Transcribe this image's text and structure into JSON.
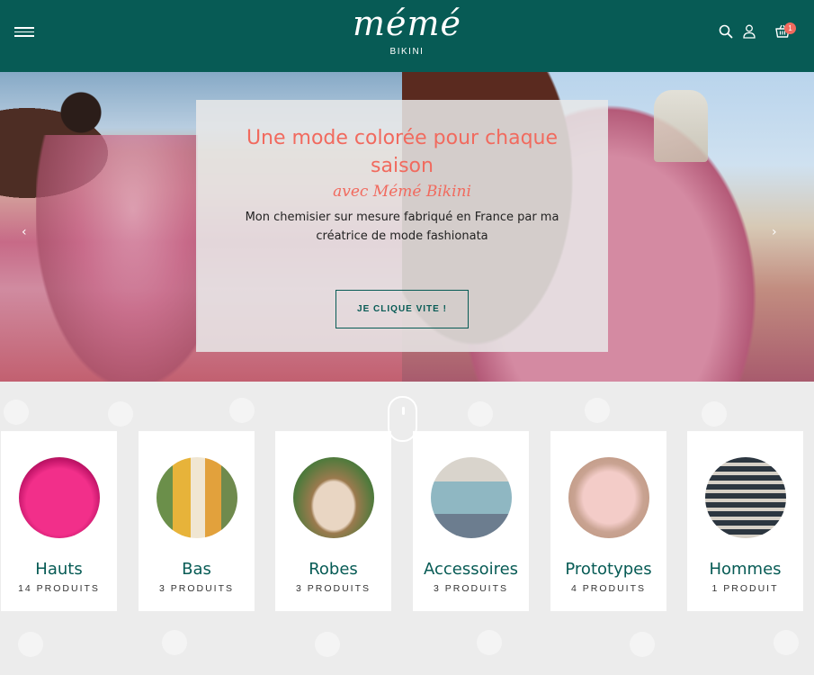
{
  "header": {
    "logo_word": "mémé",
    "logo_sub": "BIKINI",
    "cart_count": "1",
    "icons": [
      "menu-icon",
      "search-icon",
      "user-icon",
      "cart-icon"
    ]
  },
  "hero": {
    "title": "Une mode colorée pour chaque saison",
    "subtitle": "avec Mémé Bikini",
    "description": "Mon chemisier sur mesure fabriqué en France par ma créatrice de mode fashionata",
    "cta": "JE CLIQUE VITE !",
    "prev_arrow": "‹",
    "next_arrow": "›"
  },
  "categories": [
    {
      "name": "Hauts",
      "count": "14 PRODUITS"
    },
    {
      "name": "Bas",
      "count": "3 PRODUITS"
    },
    {
      "name": "Robes",
      "count": "3 PRODUITS"
    },
    {
      "name": "Accessoires",
      "count": "3 PRODUITS"
    },
    {
      "name": "Prototypes",
      "count": "4 PRODUITS"
    },
    {
      "name": "Hommes",
      "count": "1 PRODUIT"
    }
  ],
  "colors": {
    "brand": "#075b55",
    "accent": "#f16a5e",
    "background": "#ececec"
  }
}
